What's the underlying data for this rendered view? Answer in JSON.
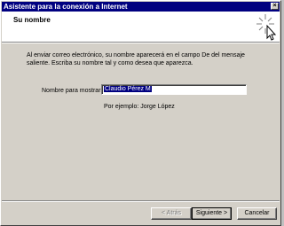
{
  "window": {
    "title": "Asistente para la conexión a Internet",
    "close_label": "×"
  },
  "header": {
    "heading": "Su nombre",
    "icon": "wizard-wand-icon"
  },
  "content": {
    "intro": "Al enviar correo electrónico, su nombre aparecerá en el campo De del mensaje saliente. Escriba su nombre tal y como desea que aparezca.",
    "field_label": "Nombre para mostrar:",
    "name_value": "Claudio Pérez M",
    "example": "Por ejemplo: Jorge López"
  },
  "buttons": {
    "back": "< Atrás",
    "next": "Siguiente >",
    "cancel": "Cancelar"
  }
}
